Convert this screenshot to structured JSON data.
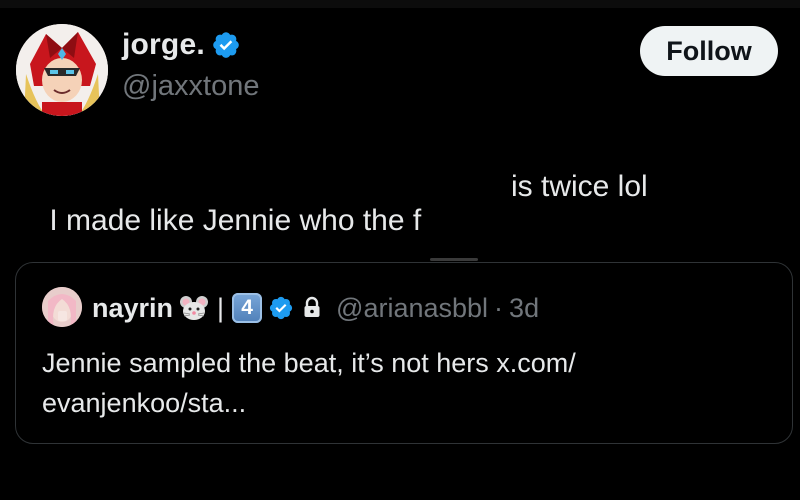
{
  "author": {
    "display_name": "jorge.",
    "handle": "@jaxxtone",
    "verified": true,
    "avatar_icon": "red-armored-character-avatar"
  },
  "follow_button": {
    "label": "Follow"
  },
  "tweet": {
    "text_part1": "I made like Jennie who the f",
    "text_part2": "is twice lol"
  },
  "quote": {
    "display_name": "nayrin",
    "emoji_icon": "mouse-face-emoji",
    "separator": "|",
    "keycap": "4",
    "verified": true,
    "locked": true,
    "handle": "@arianasbbl",
    "dot": "·",
    "time": "3d",
    "text": "Jennie sampled the beat, it’s not hers x.com/ evanjenkoo/sta..."
  },
  "colors": {
    "background": "#000000",
    "text_primary": "#e7e9ea",
    "text_secondary": "#71767b",
    "verified_blue": "#1d9bf0",
    "follow_bg": "#eff3f4",
    "card_border": "#2f3336"
  }
}
